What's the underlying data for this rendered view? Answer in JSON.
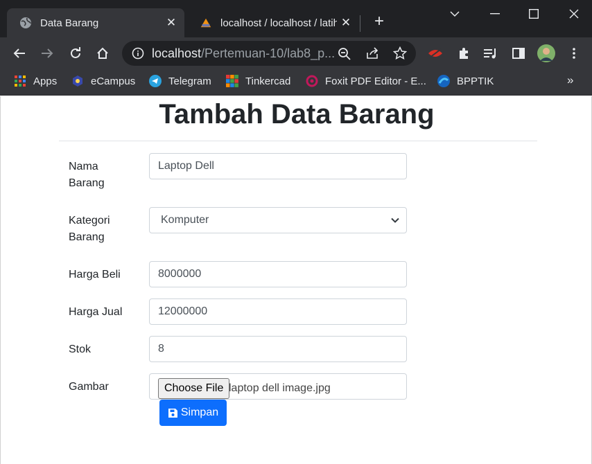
{
  "browser": {
    "tabs": [
      {
        "title": "Data Barang",
        "icon": "globe-icon"
      },
      {
        "title": "localhost / localhost / latih",
        "icon": "phpmyadmin-icon"
      }
    ],
    "url_host": "localhost",
    "url_path": "/Pertemuan-10/lab8_p...",
    "bookmarks": [
      {
        "label": "Apps",
        "icon": "apps-grid-icon"
      },
      {
        "label": "eCampus",
        "icon": "ecampus-icon"
      },
      {
        "label": "Telegram",
        "icon": "telegram-icon"
      },
      {
        "label": "Tinkercad",
        "icon": "tinkercad-icon"
      },
      {
        "label": "Foxit PDF Editor - E...",
        "icon": "foxit-icon"
      },
      {
        "label": "BPPTIK",
        "icon": "bpptik-icon"
      }
    ],
    "more": "»"
  },
  "page": {
    "heading": "Tambah Data Barang",
    "labels": {
      "nama_line1": "Nama",
      "nama_line2": "Barang",
      "kategori_line1": "Kategori",
      "kategori_line2": "Barang",
      "harga_beli": "Harga Beli",
      "harga_jual": "Harga Jual",
      "stok": "Stok",
      "gambar": "Gambar"
    },
    "values": {
      "nama": "Laptop Dell",
      "kategori": "Komputer",
      "harga_beli": "8000000",
      "harga_jual": "12000000",
      "stok": "8",
      "file_button": "Choose File",
      "file_name": "laptop dell image.jpg"
    },
    "submit_label": "Simpan"
  },
  "colors": {
    "primary": "#0d6efd",
    "chrome_dark": "#202124",
    "chrome_toolbar": "#35363a"
  }
}
